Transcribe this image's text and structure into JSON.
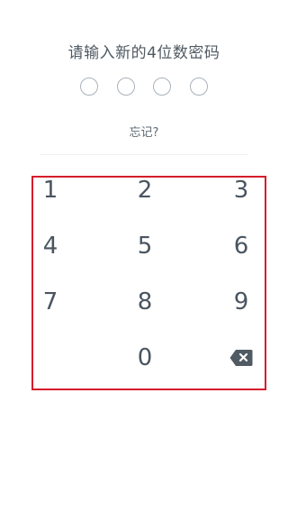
{
  "header": {
    "title": "请输入新的4位数密码"
  },
  "pin": {
    "length": 4,
    "entered": 0
  },
  "forgot_label": "忘记?",
  "keypad": {
    "keys": [
      "1",
      "2",
      "3",
      "4",
      "5",
      "6",
      "7",
      "8",
      "9",
      "0"
    ],
    "delete_icon": "backspace-icon"
  },
  "colors": {
    "text": "#4a5560",
    "dot_border": "#a9b2ba",
    "highlight_border": "#d51c2b"
  }
}
